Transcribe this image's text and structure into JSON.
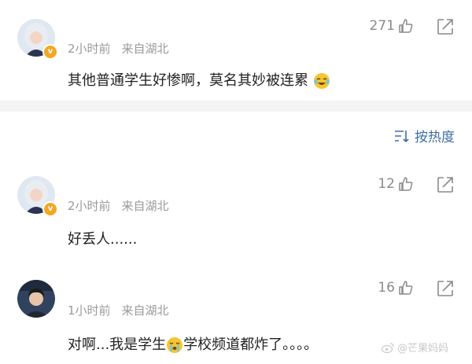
{
  "comments": [
    {
      "time": "2小时前",
      "location": "来自湖北",
      "likes": "271",
      "text_before": "其他普通学生好惨啊，莫名其妙被连累",
      "text_after": ""
    },
    {
      "time": "2小时前",
      "location": "来自湖北",
      "likes": "12",
      "text_before": "好丢人......",
      "text_after": ""
    },
    {
      "time": "1小时前",
      "location": "来自湖北",
      "likes": "16",
      "text_before": "对啊...我是学生",
      "text_after": "学校频道都炸了。。。。"
    }
  ],
  "sort": {
    "label": "按热度"
  },
  "watermark": {
    "text": "@芒果妈妈"
  },
  "colors": {
    "link_blue": "#3f6ea6",
    "verified_badge": "#f5a623",
    "meta_gray": "#9a9a9a",
    "divider": "#f4f4f4"
  }
}
